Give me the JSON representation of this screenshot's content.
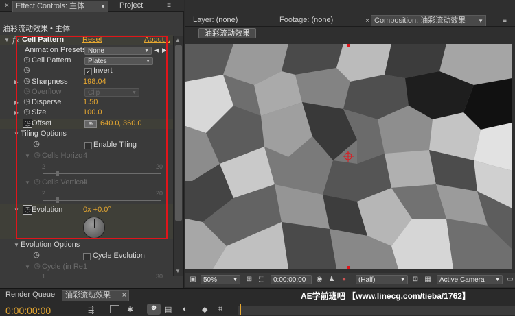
{
  "effect_panel": {
    "tab_effect_controls": "Effect Controls: 主体",
    "tab_project": "Project",
    "breadcrumb": "油彩流动效果 • 主体",
    "effect_name": "Cell Pattern",
    "reset_label": "Reset",
    "about_label": "About...",
    "animation_presets_label": "Animation Presets:",
    "animation_presets_value": "None",
    "cell_pattern_label": "Cell Pattern",
    "cell_pattern_value": "Plates",
    "invert_label": "Invert",
    "invert_checked": true,
    "sharpness_label": "Sharpness",
    "sharpness_value": "198.04",
    "overflow_label": "Overflow",
    "overflow_value": "Clip",
    "disperse_label": "Disperse",
    "disperse_value": "1.50",
    "size_label": "Size",
    "size_value": "100.0",
    "offset_label": "Offset",
    "offset_x": "640.0",
    "offset_y": "360.0",
    "tiling_options_label": "Tiling Options",
    "enable_tiling_label": "Enable Tiling",
    "cells_horizontal_label": "Cells Horizo",
    "cells_horizontal_value": "4",
    "cells_horizontal_min": "2",
    "cells_horizontal_max": "20",
    "cells_vertical_label": "Cells Vertical",
    "cells_vertical_value": "4",
    "cells_vertical_min": "2",
    "cells_vertical_max": "20",
    "evolution_label": "Evolution",
    "evolution_value": "0x +0.0°",
    "evolution_options_label": "Evolution Options",
    "cycle_evolution_label": "Cycle Evolution",
    "cycle_label": "Cycle (in Re",
    "cycle_value": "1",
    "cycle_min": "1",
    "cycle_max": "30"
  },
  "viewer": {
    "tab_layer": "Layer: (none)",
    "tab_footage": "Footage: (none)",
    "tab_composition": "Composition: 油彩流动效果",
    "comp_button": "油彩流动效果",
    "zoom": "50%",
    "timecode": "0:00:00:00",
    "resolution": "(Half)",
    "camera": "Active Camera"
  },
  "bottom": {
    "tab_render_queue": "Render Queue",
    "tab_timeline": "油彩流动效果",
    "timecode": "0:00:00:00",
    "watermark": "AE学前班吧 【www.linecg.com/tieba/1762】"
  },
  "colors": {
    "accent_value": "#e7a831",
    "highlight_box": "#e0151b"
  }
}
